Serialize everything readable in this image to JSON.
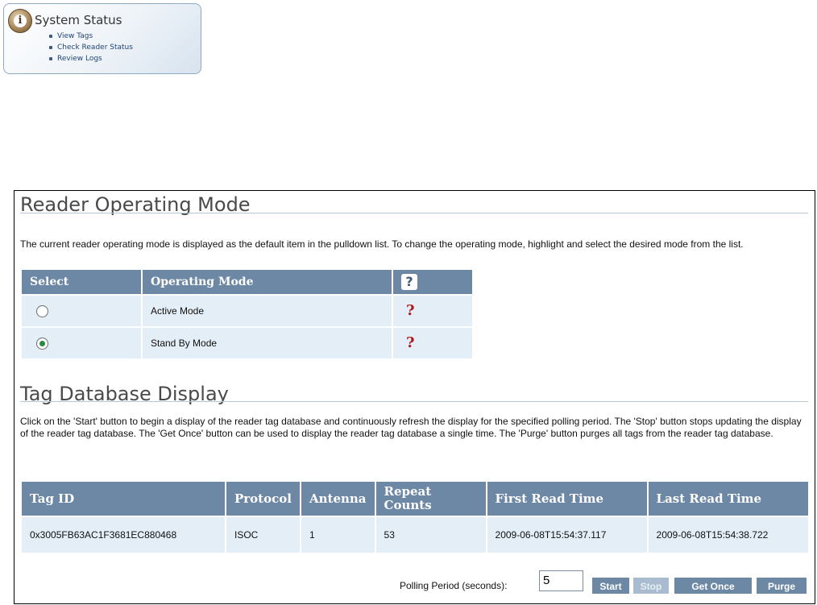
{
  "status_card": {
    "title": "System Status",
    "links": [
      "View Tags",
      "Check Reader Status",
      "Review Logs"
    ]
  },
  "mode_section": {
    "title": "Reader Operating Mode",
    "description": "The current reader operating mode is displayed as the default item in the pulldown list. To change the operating mode, highlight and select the desired mode from the list.",
    "columns": [
      "Select",
      "Operating Mode",
      "?"
    ],
    "rows": [
      {
        "mode": "Active Mode",
        "selected": false,
        "help": "?"
      },
      {
        "mode": "Stand By Mode",
        "selected": true,
        "help": "?"
      }
    ]
  },
  "tag_section": {
    "title": "Tag Database Display",
    "description": "Click on the 'Start' button to begin a display of the reader tag database and continuously refresh the display for the specified polling period. The 'Stop' button stops updating the display of the reader tag database. The 'Get Once' button can be used to display the reader tag database a single time. The 'Purge' button purges all tags from the reader tag database.",
    "columns": [
      "Tag ID",
      "Protocol",
      "Antenna",
      "Repeat Counts",
      "First Read Time",
      "Last Read Time"
    ],
    "rows": [
      {
        "tag_id": "0x3005FB63AC1F3681EC880468",
        "protocol": "ISOC",
        "antenna": "1",
        "repeat_counts": "53",
        "first_read": "2009-06-08T15:54:37.117",
        "last_read": "2009-06-08T15:54:38.722"
      }
    ]
  },
  "polling": {
    "label": "Polling Period (seconds):",
    "value": "5"
  },
  "buttons": {
    "start": "Start",
    "stop": "Stop",
    "get_once": "Get Once",
    "purge": "Purge"
  },
  "colors": {
    "header_bg": "#6d88a4",
    "cell_bg": "#e4eef6",
    "help_mark": "#b0181e",
    "radio_on": "#2b8a3e"
  }
}
